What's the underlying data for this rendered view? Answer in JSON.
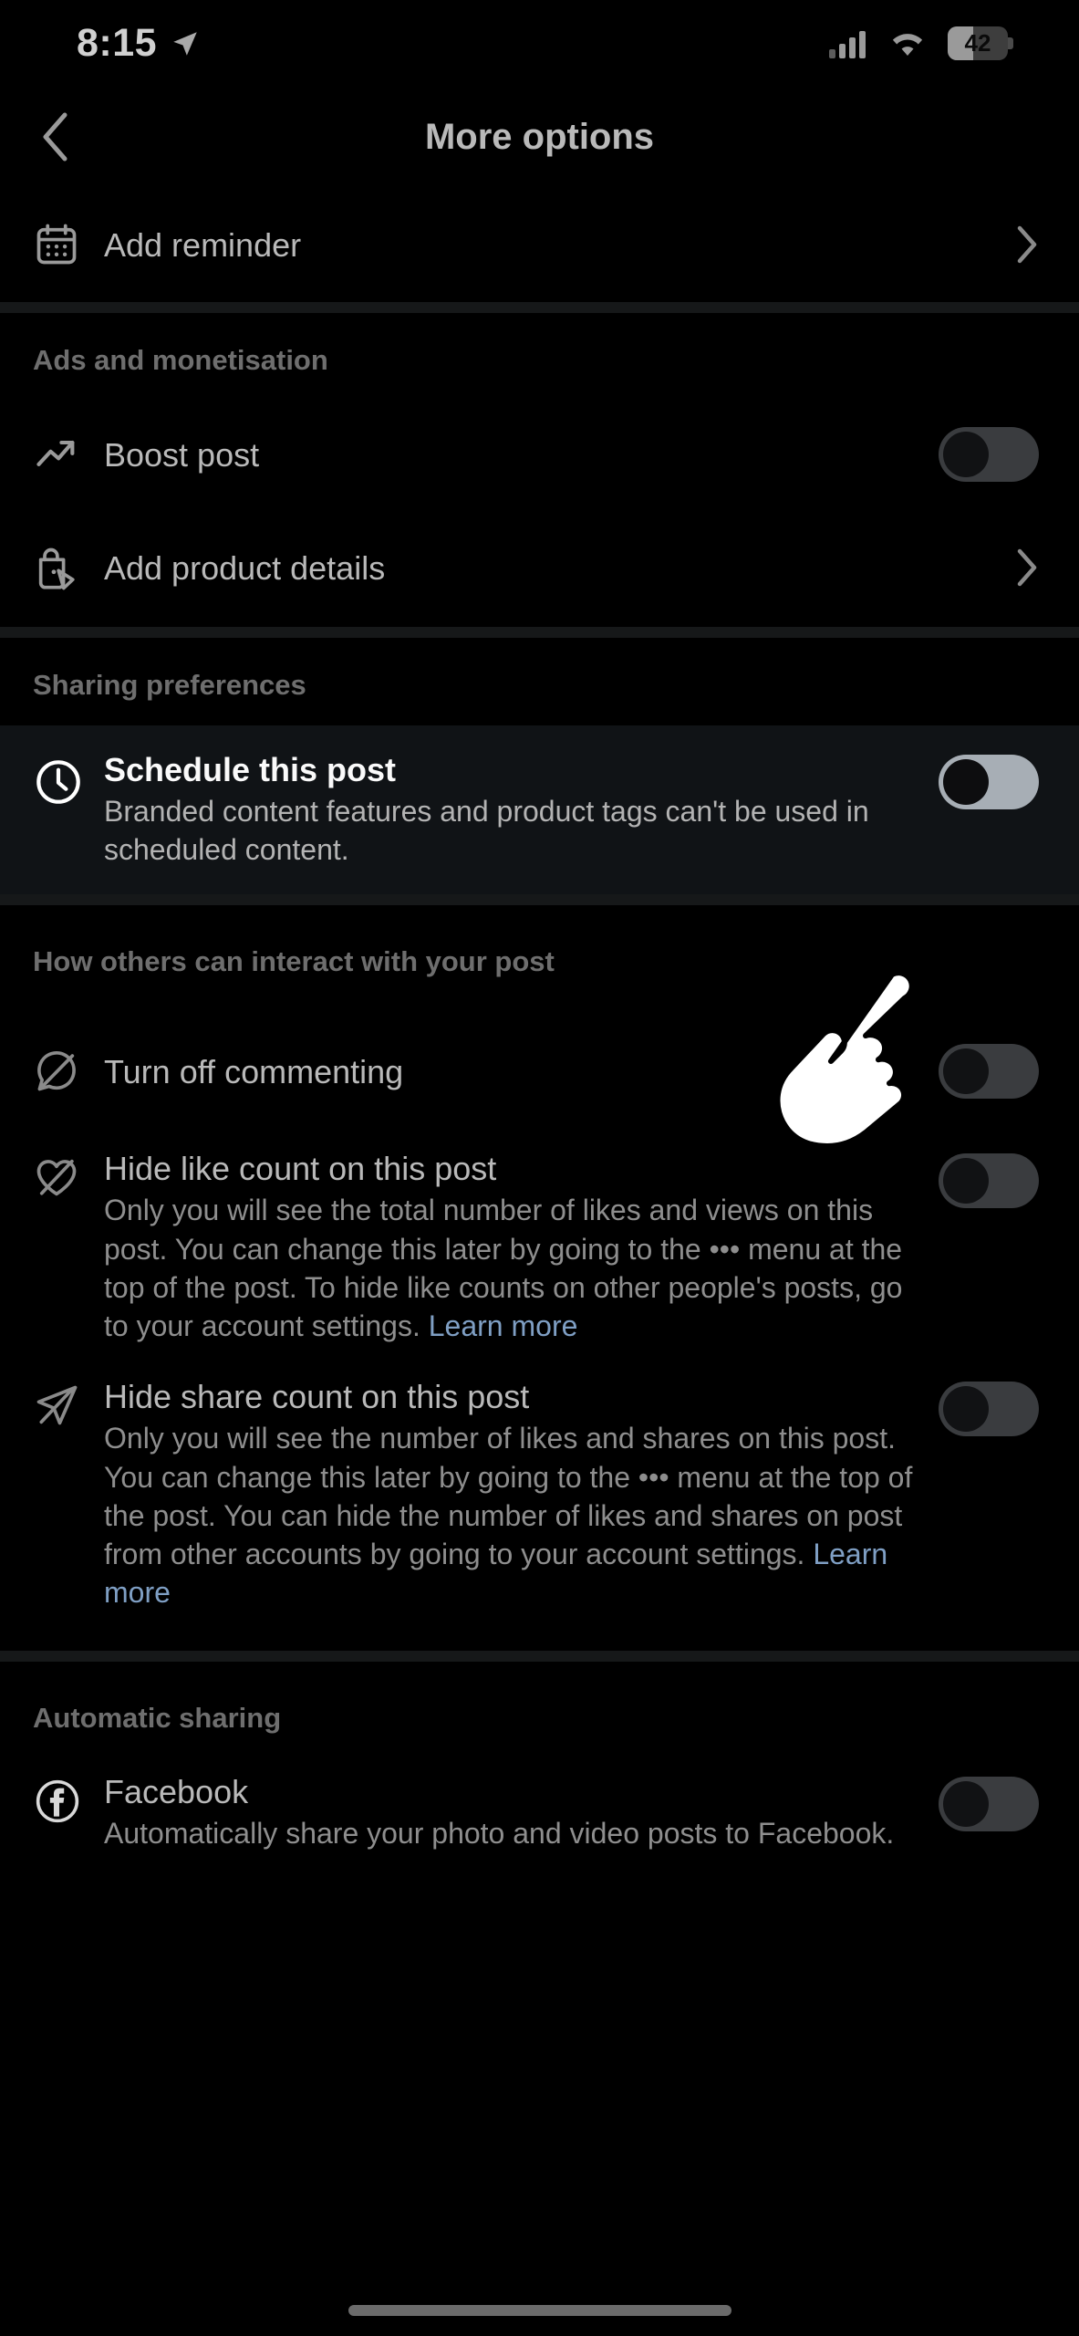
{
  "status_bar": {
    "time": "8:15",
    "location_icon": "location-arrow-icon",
    "cellular_icon": "cellular-signal-icon",
    "wifi_icon": "wifi-icon",
    "battery_level": "42",
    "battery_percent": 42
  },
  "header": {
    "title": "More options",
    "back_icon": "chevron-left-icon"
  },
  "rows": {
    "add_reminder": {
      "title": "Add reminder",
      "icon": "calendar-icon",
      "trailing": "chevron-right-icon"
    },
    "boost_post": {
      "title": "Boost post",
      "icon": "trending-up-icon",
      "toggle_state": "off"
    },
    "add_product_details": {
      "title": "Add product details",
      "icon": "shopping-tag-icon",
      "trailing": "chevron-right-icon"
    },
    "schedule_post": {
      "title": "Schedule this post",
      "desc": "Branded content features and product tags can't be used in scheduled content.",
      "icon": "clock-icon",
      "toggle_state": "off"
    },
    "turn_off_commenting": {
      "title": "Turn off commenting",
      "icon": "comment-off-icon",
      "toggle_state": "off"
    },
    "hide_like_count": {
      "title": "Hide like count on this post",
      "desc": "Only you will see the total number of likes and views on this post. You can change this later by going to the ••• menu at the top of the post. To hide like counts on other people's posts, go to your account settings. ",
      "learn_more": "Learn more",
      "icon": "heart-off-icon",
      "toggle_state": "off"
    },
    "hide_share_count": {
      "title": "Hide share count on this post",
      "desc": "Only you will see the number of likes and shares on this post. You can change this later by going to the ••• menu at the top of the post. You can hide the number of likes and shares on post from other accounts by going to your account settings. ",
      "learn_more": "Learn more",
      "icon": "share-off-icon",
      "toggle_state": "off"
    },
    "facebook": {
      "title": "Facebook",
      "desc": "Automatically share your photo and video posts to Facebook.",
      "icon": "facebook-icon",
      "toggle_state": "off"
    }
  },
  "sections": {
    "ads_and_monetisation": "Ads and monetisation",
    "sharing_preferences": "Sharing preferences",
    "how_others_interact": "How others can interact with your post",
    "automatic_sharing": "Automatic sharing"
  },
  "colors": {
    "background": "#000000",
    "divider": "#161819",
    "highlight_row": "#101316",
    "toggle_off_track": "#3a3c3f",
    "toggle_highlight_track": "#a7aeb5",
    "link": "#7f9fc4",
    "primary_text": "#b9b9b9",
    "secondary_text": "#8e8e8e"
  },
  "cursor": {
    "icon": "pointing-hand-cursor"
  }
}
